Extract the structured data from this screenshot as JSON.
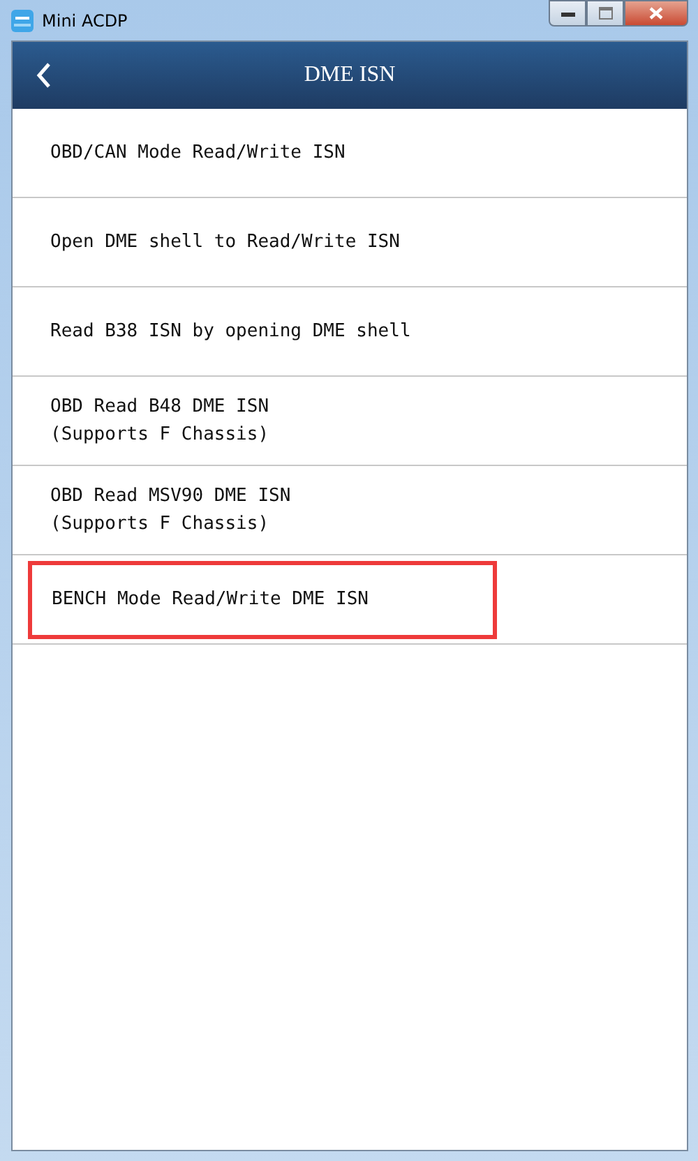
{
  "window": {
    "title": "Mini ACDP"
  },
  "header": {
    "title": "DME ISN"
  },
  "items": [
    {
      "lines": [
        "OBD/CAN Mode Read/Write ISN"
      ],
      "highlighted": false
    },
    {
      "lines": [
        "Open DME shell to Read/Write ISN"
      ],
      "highlighted": false
    },
    {
      "lines": [
        "Read B38 ISN by opening DME shell"
      ],
      "highlighted": false
    },
    {
      "lines": [
        "OBD Read B48 DME ISN",
        "(Supports F Chassis)"
      ],
      "highlighted": false
    },
    {
      "lines": [
        "OBD Read MSV90 DME ISN",
        "(Supports F Chassis)"
      ],
      "highlighted": false
    },
    {
      "lines": [
        "BENCH Mode Read/Write DME ISN"
      ],
      "highlighted": true
    }
  ]
}
